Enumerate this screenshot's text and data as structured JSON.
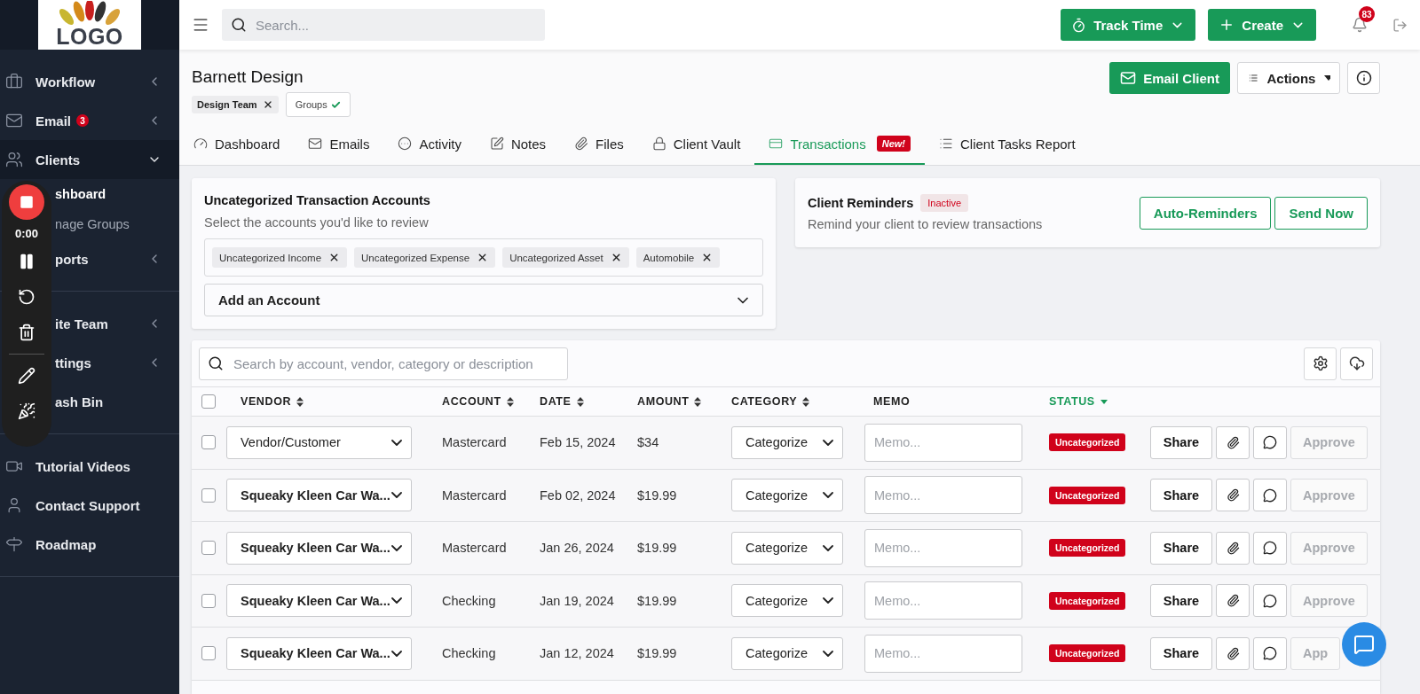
{
  "sidebar": {
    "logo": "LOGO",
    "sections": [
      [
        {
          "label": "Workflow",
          "expanded": false
        },
        {
          "label": "Email",
          "badge": "3",
          "expanded": false
        },
        {
          "label": "Clients",
          "expanded": true,
          "children": [
            {
              "label": "shboard",
              "selected": true
            },
            {
              "label": "nage Groups",
              "selected": false
            }
          ]
        },
        {
          "label": "ports",
          "expanded": false,
          "clipped": true
        }
      ],
      [
        {
          "label": "ite Team",
          "expanded": false,
          "clipped": true
        },
        {
          "label": "ttings",
          "expanded": false,
          "clipped": true
        },
        {
          "label": "ash Bin",
          "clipped": true
        }
      ],
      [
        {
          "label": "Tutorial Videos"
        },
        {
          "label": "Contact Support"
        },
        {
          "label": "Roadmap"
        }
      ]
    ]
  },
  "recorder": {
    "timer": "0:00"
  },
  "topbar": {
    "search": {
      "placeholder": "Search..."
    },
    "buttons": [
      "Track Time",
      "Create"
    ],
    "notifications": "83"
  },
  "client": {
    "name": "Barnett Design",
    "tags": [
      "Design Team"
    ],
    "groups_button": "Groups",
    "email_button": "Email Client",
    "actions_button": "Actions"
  },
  "tabs": [
    {
      "label": "Dashboard",
      "selected": false
    },
    {
      "label": "Emails",
      "selected": false
    },
    {
      "label": "Activity",
      "selected": false
    },
    {
      "label": "Notes",
      "selected": false
    },
    {
      "label": "Files",
      "selected": false
    },
    {
      "label": "Client Vault",
      "selected": false
    },
    {
      "label": "Transactions",
      "selected": true,
      "badge": "New!"
    },
    {
      "label": "Client Tasks Report",
      "selected": false
    }
  ],
  "accounts_card": {
    "title": "Uncategorized Transaction Accounts",
    "subtitle": "Select the accounts you'd like to review",
    "accounts": [
      "Uncategorized Income",
      "Uncategorized Expense",
      "Uncategorized Asset",
      "Automobile"
    ],
    "add_account": "Add an Account"
  },
  "reminders_card": {
    "title": "Client Reminders",
    "status": "Inactive",
    "subtitle": "Remind your client to review transactions",
    "buttons": [
      "Auto-Reminders",
      "Send Now"
    ]
  },
  "table": {
    "search": {
      "placeholder": "Search by account, vendor, category or description"
    },
    "all_checked": false,
    "columns": [
      {
        "label": "VENDOR",
        "sortable": true,
        "sorted": false
      },
      {
        "label": "ACCOUNT",
        "sortable": true,
        "sorted": false
      },
      {
        "label": "DATE",
        "sortable": true,
        "sorted": false
      },
      {
        "label": "AMOUNT",
        "sortable": true,
        "sorted": false
      },
      {
        "label": "CATEGORY",
        "sortable": true,
        "sorted": false
      },
      {
        "label": "MEMO",
        "sortable": false,
        "sorted": false
      },
      {
        "label": "STATUS",
        "sortable": true,
        "sorted": true
      }
    ],
    "rows": [
      {
        "checked": false,
        "vendor": "Vendor/Customer",
        "vendor_set": false,
        "account": "Mastercard",
        "date": "Feb 15, 2024",
        "amount": "$34",
        "category": "Categorize",
        "memo_placeholder": "Memo...",
        "status": "Uncategorized",
        "share": "Share",
        "approve": "Approve",
        "approve_disabled": true
      },
      {
        "checked": false,
        "vendor": "Squeaky Kleen Car Wa...",
        "vendor_set": true,
        "account": "Mastercard",
        "date": "Feb 02, 2024",
        "amount": "$19.99",
        "category": "Categorize",
        "memo_placeholder": "Memo...",
        "status": "Uncategorized",
        "share": "Share",
        "approve": "Approve",
        "approve_disabled": true
      },
      {
        "checked": false,
        "vendor": "Squeaky Kleen Car Wa...",
        "vendor_set": true,
        "account": "Mastercard",
        "date": "Jan 26, 2024",
        "amount": "$19.99",
        "category": "Categorize",
        "memo_placeholder": "Memo...",
        "status": "Uncategorized",
        "share": "Share",
        "approve": "Approve",
        "approve_disabled": true
      },
      {
        "checked": false,
        "vendor": "Squeaky Kleen Car Wa...",
        "vendor_set": true,
        "account": "Checking",
        "date": "Jan 19, 2024",
        "amount": "$19.99",
        "category": "Categorize",
        "memo_placeholder": "Memo...",
        "status": "Uncategorized",
        "share": "Share",
        "approve": "Approve",
        "approve_disabled": true
      },
      {
        "checked": false,
        "vendor": "Squeaky Kleen Car Wa...",
        "vendor_set": true,
        "account": "Checking",
        "date": "Jan 12, 2024",
        "amount": "$19.99",
        "category": "Categorize",
        "memo_placeholder": "Memo...",
        "status": "Uncategorized",
        "share": "Share",
        "approve": "App",
        "approve_disabled": true
      }
    ]
  }
}
